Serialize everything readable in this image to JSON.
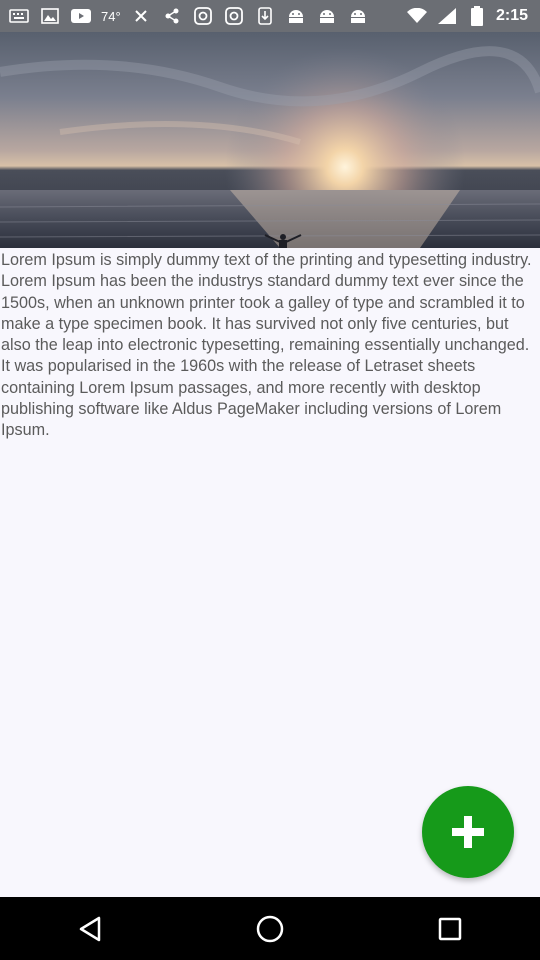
{
  "status_bar": {
    "temperature": "74°",
    "time": "2:15",
    "icons": [
      "keyboard-icon",
      "photo-icon",
      "youtube-icon",
      "weather-icon",
      "sparkle-icon",
      "instagram-icon",
      "instagram-icon",
      "download-icon",
      "android-icon",
      "android-icon",
      "android-icon",
      "wifi-icon",
      "signal-icon",
      "battery-icon"
    ]
  },
  "hero": {
    "alt": "sunset over ocean"
  },
  "content": {
    "paragraph": "Lorem Ipsum is simply dummy text of the printing and typesetting industry. Lorem Ipsum has been the industrys standard dummy text ever since the 1500s, when an unknown printer took a galley of type and scrambled it to make a type specimen book. It has survived not only five centuries, but also the leap into electronic typesetting, remaining essentially unchanged. It was popularised in the 1960s with the release of Letraset sheets containing Lorem Ipsum passages, and more recently with desktop publishing software like Aldus PageMaker including versions of Lorem Ipsum."
  },
  "fab": {
    "icon": "plus-icon",
    "color": "#169a1a"
  },
  "nav_bar": {
    "buttons": [
      "back-icon",
      "home-icon",
      "recents-icon"
    ]
  }
}
